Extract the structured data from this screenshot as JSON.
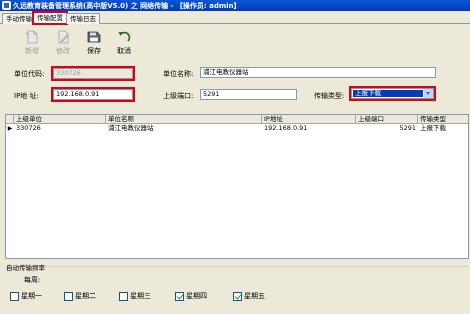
{
  "window": {
    "title": "久远教育装备管理系统(高中版V5.0) 之 网络传输 - 【操作员: admin】"
  },
  "tabs": [
    {
      "label": "手动传输",
      "active": false
    },
    {
      "label": "传输配置",
      "active": true
    },
    {
      "label": "传输日志",
      "active": false
    }
  ],
  "toolbar": {
    "new_label": "新增",
    "edit_label": "修改",
    "save_label": "保存",
    "cancel_label": "取消"
  },
  "form": {
    "unit_code_label": "单位代码:",
    "unit_code_value": "330726",
    "unit_name_label": "单位名称:",
    "unit_name_value": "浦江电教仪器站",
    "ip_label": "IP地 址:",
    "ip_value": "192.168.0.91",
    "port_label": "上级端口:",
    "port_value": "5291",
    "type_label": "传输类型:",
    "type_value": "上报下载"
  },
  "grid": {
    "columns": [
      "上级单位",
      "单位名称",
      "IP地址",
      "上级端口",
      "传输类型"
    ],
    "rows": [
      {
        "indicator": "▶",
        "cells": [
          "330726",
          "浦江电教仪器站",
          "192.168.0.91",
          "5291",
          "上报下载"
        ]
      }
    ]
  },
  "frequency": {
    "section_title": "自动传输频率",
    "weekly_label": "每周:",
    "days": [
      {
        "label": "星期一",
        "checked": false
      },
      {
        "label": "星期二",
        "checked": false
      },
      {
        "label": "星期三",
        "checked": false
      },
      {
        "label": "星期四",
        "checked": true
      },
      {
        "label": "星期五",
        "checked": true
      }
    ]
  },
  "colors": {
    "highlight": "#e00010",
    "title_bar": "#0a55d8",
    "selection": "#0a3bb4"
  }
}
